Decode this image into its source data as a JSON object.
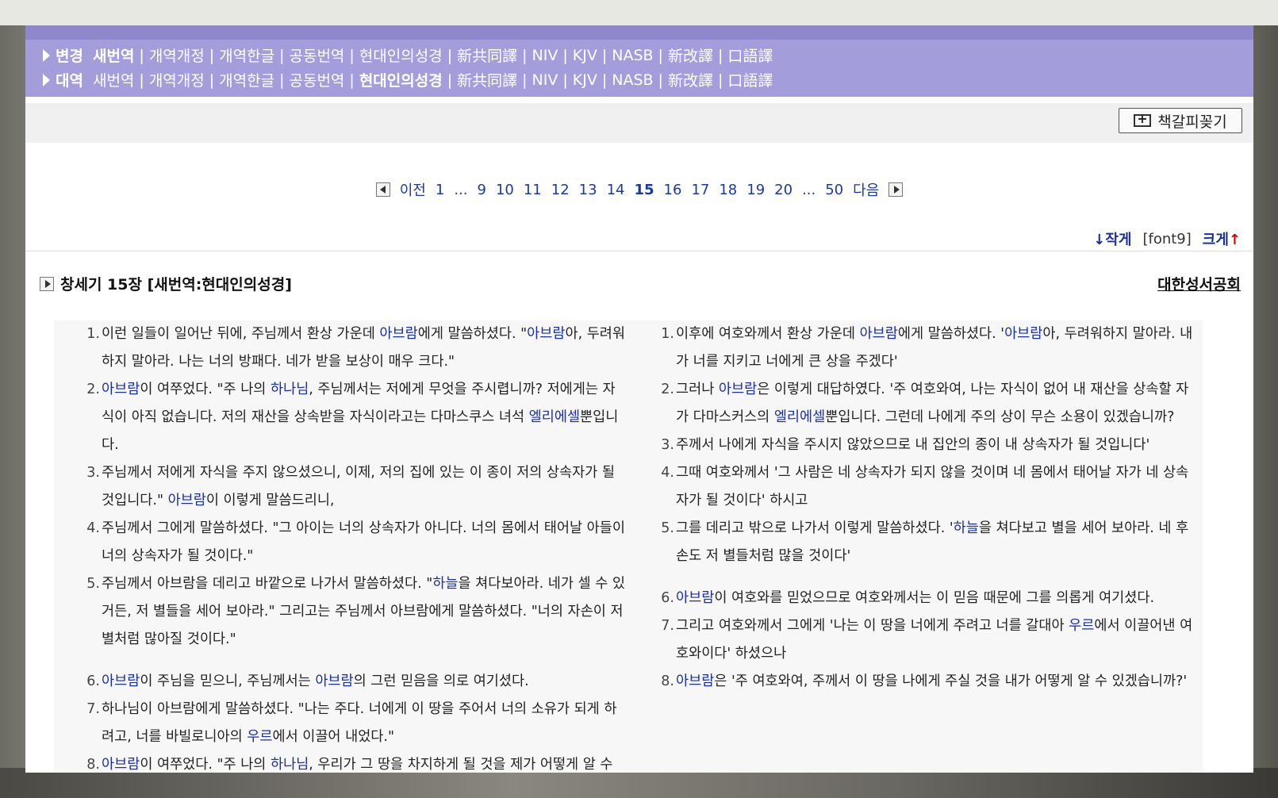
{
  "nav": {
    "row1": {
      "label": "변경",
      "items": [
        "새번역",
        "개역개정",
        "개역한글",
        "공동번역",
        "현대인의성경",
        "新共同譯",
        "NIV",
        "KJV",
        "NASB",
        "新改譯",
        "口語譯"
      ],
      "current_index": 0
    },
    "row2": {
      "label": "대역",
      "items": [
        "새번역",
        "개역개정",
        "개역한글",
        "공동번역",
        "현대인의성경",
        "新共同譯",
        "NIV",
        "KJV",
        "NASB",
        "新改譯",
        "口語譯"
      ],
      "current_index": 4
    }
  },
  "toolbar": {
    "bookmark_label": "책갈피꽂기"
  },
  "pager": {
    "prev": "이전",
    "next": "다음",
    "pages": [
      "1",
      "...",
      "9",
      "10",
      "11",
      "12",
      "13",
      "14",
      "15",
      "16",
      "17",
      "18",
      "19",
      "20",
      "...",
      "50"
    ],
    "current": "15"
  },
  "font_size": {
    "smaller": "작게",
    "current": "[font9]",
    "larger": "크게"
  },
  "chapter": {
    "title": "창세기 15장 [새번역:현대인의성경]",
    "publisher": "대한성서공회"
  },
  "left_verses": [
    {
      "num": "1.",
      "parts": [
        [
          "이런 일들이 일어난 뒤에, 주님께서 환상 가운데 ",
          0
        ],
        [
          "아브람",
          1
        ],
        [
          "에게 말씀하셨다. \"",
          0
        ],
        [
          "아브람",
          1
        ],
        [
          "아, 두려워하지 말아라. 나는 너의 방패다. 네가 받을 보상이 매우 크다.\"",
          0
        ]
      ]
    },
    {
      "num": "2.",
      "parts": [
        [
          "아브람",
          1
        ],
        [
          "이 여쭈었다. \"주 나의 ",
          0
        ],
        [
          "하나님",
          1
        ],
        [
          ", 주님께서는 저에게 무엇을 주시렵니까? 저에게는 자식이 아직 없습니다. 저의 재산을 상속받을 자식이라고는 다마스쿠스 녀석 ",
          0
        ],
        [
          "엘리에셀",
          1
        ],
        [
          "뿐입니다.",
          0
        ]
      ]
    },
    {
      "num": "3.",
      "parts": [
        [
          "주님께서 저에게 자식을 주지 않으셨으니, 이제, 저의 집에 있는 이 종이 저의 상속자가 될 것입니다.\" ",
          0
        ],
        [
          "아브람",
          1
        ],
        [
          "이 이렇게 말씀드리니,",
          0
        ]
      ]
    },
    {
      "num": "4.",
      "parts": [
        [
          "주님께서 그에게 말씀하셨다. \"그 아이는 너의 상속자가 아니다. 너의 몸에서 태어날 아들이 너의 상속자가 될 것이다.\"",
          0
        ]
      ]
    },
    {
      "num": "5.",
      "parts": [
        [
          "주님께서 아브람을 데리고 바깥으로 나가서 말씀하셨다. \"",
          0
        ],
        [
          "하늘",
          1
        ],
        [
          "을 쳐다보아라. 네가 셀 수 있거든, 저 별들을 세어 보아라.\" 그리고는 주님께서 아브람에게 말씀하셨다. \"너의 자손이 저 별처럼 많아질 것이다.\"",
          0
        ]
      ]
    },
    {
      "num": "6.",
      "parts": [
        [
          "아브람",
          1
        ],
        [
          "이 주님을 믿으니, 주님께서는 ",
          0
        ],
        [
          "아브람",
          1
        ],
        [
          "의 그런 믿음을 의로 여기셨다.",
          0
        ]
      ]
    },
    {
      "num": "7.",
      "parts": [
        [
          "하나님이 아브람에게 말씀하셨다. \"나는 주다. 너에게 이 땅을 주어서 너의 소유가 되게 하려고, 너를 바빌로니아의 ",
          0
        ],
        [
          "우르",
          1
        ],
        [
          "에서 이끌어 내었다.\"",
          0
        ]
      ]
    },
    {
      "num": "8.",
      "parts": [
        [
          "아브람",
          1
        ],
        [
          "이 여쭈었다. \"주 나의 ",
          0
        ],
        [
          "하나님",
          1
        ],
        [
          ", 우리가 그 땅을 차지하게 될 것을 제가 어떻게 알 수",
          0
        ]
      ]
    }
  ],
  "right_verses": [
    {
      "num": "1.",
      "parts": [
        [
          "이후에 여호와께서 환상 가운데 ",
          0
        ],
        [
          "아브람",
          1
        ],
        [
          "에게 말씀하셨다. '",
          0
        ],
        [
          "아브람",
          1
        ],
        [
          "아, 두려워하지 말아라. 내가 너를 지키고 너에게 큰 상을 주겠다'",
          0
        ]
      ]
    },
    {
      "num": "2.",
      "parts": [
        [
          "그러나 ",
          0
        ],
        [
          "아브람",
          1
        ],
        [
          "은 이렇게 대답하였다. '주 여호와여, 나는 자식이 없어 내 재산을 상속할 자가 다마스커스의 ",
          0
        ],
        [
          "엘리에셀",
          1
        ],
        [
          "뿐입니다. 그런데 나에게 주의 상이 무슨 소용이 있겠습니까?",
          0
        ]
      ]
    },
    {
      "num": "3.",
      "parts": [
        [
          "주께서 나에게 자식을 주시지 않았으므로 내 집안의 종이 내 상속자가 될 것입니다'",
          0
        ]
      ]
    },
    {
      "num": "4.",
      "parts": [
        [
          "그때 여호와께서 '그 사람은 네 상속자가 되지 않을 것이며 네 몸에서 태어날 자가 네 상속자가 될 것이다' 하시고",
          0
        ]
      ]
    },
    {
      "num": "5.",
      "parts": [
        [
          "그를 데리고 밖으로 나가서 이렇게 말씀하셨다. '",
          0
        ],
        [
          "하늘",
          1
        ],
        [
          "을 쳐다보고 별을 세어 보아라. 네 후손도 저 별들처럼 많을 것이다'",
          0
        ]
      ]
    },
    {
      "num": "6.",
      "parts": [
        [
          "아브람",
          1
        ],
        [
          "이 여호와를 믿었으므로 여호와께서는 이 믿음 때문에 그를 의롭게 여기셨다.",
          0
        ]
      ]
    },
    {
      "num": "7.",
      "parts": [
        [
          "그리고 여호와께서 그에게 '나는 이 땅을 너에게 주려고 너를 갈대아 ",
          0
        ],
        [
          "우르",
          1
        ],
        [
          "에서 이끌어낸 여호와이다' 하셨으나",
          0
        ]
      ]
    },
    {
      "num": "8.",
      "parts": [
        [
          "아브람",
          1
        ],
        [
          "은 '주 여호와여, 주께서 이 땅을 나에게 주실 것을 내가 어떻게 알 수 있겠습니까?'",
          0
        ]
      ]
    }
  ]
}
